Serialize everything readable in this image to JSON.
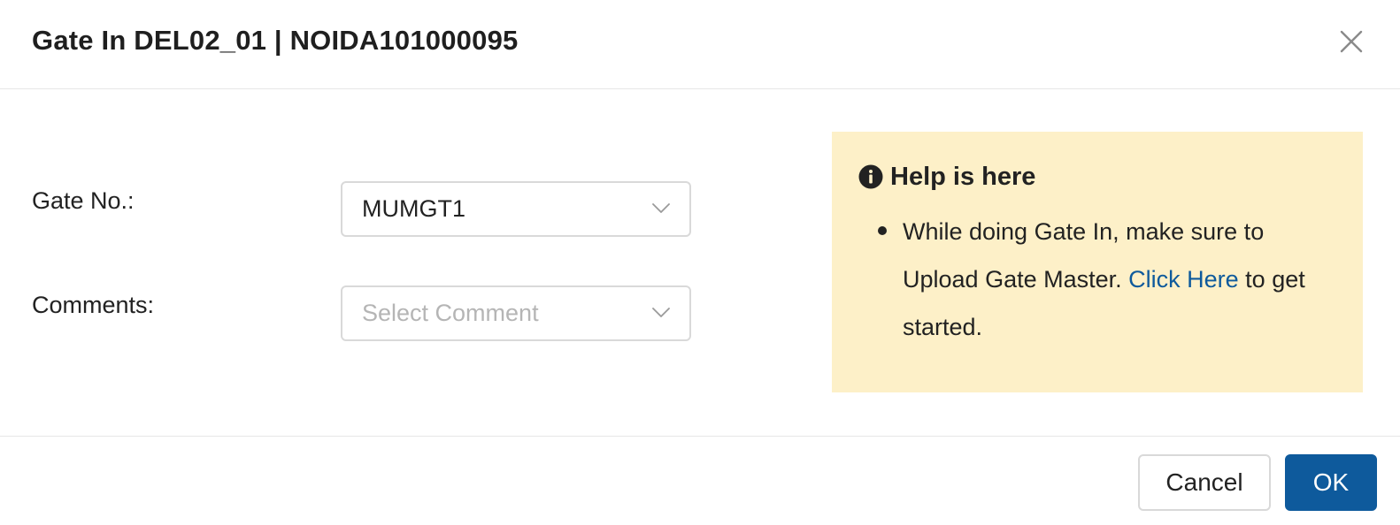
{
  "dialog": {
    "title": "Gate In DEL02_01 | NOIDA101000095",
    "close_icon": "close-icon"
  },
  "form": {
    "gate_no": {
      "label": "Gate No.:",
      "value": "MUMGT1"
    },
    "comments": {
      "label": "Comments:",
      "placeholder": "Select Comment"
    }
  },
  "help": {
    "icon": "info-icon",
    "title": "Help is here",
    "text_before": "While doing Gate In, make sure to Upload Gate Master. ",
    "link_text": "Click Here",
    "text_after": " to get started."
  },
  "footer": {
    "cancel_label": "Cancel",
    "ok_label": "OK"
  },
  "colors": {
    "primary": "#0e5a9c",
    "help_background": "#fdf0c8",
    "placeholder": "#b5b5b5"
  }
}
